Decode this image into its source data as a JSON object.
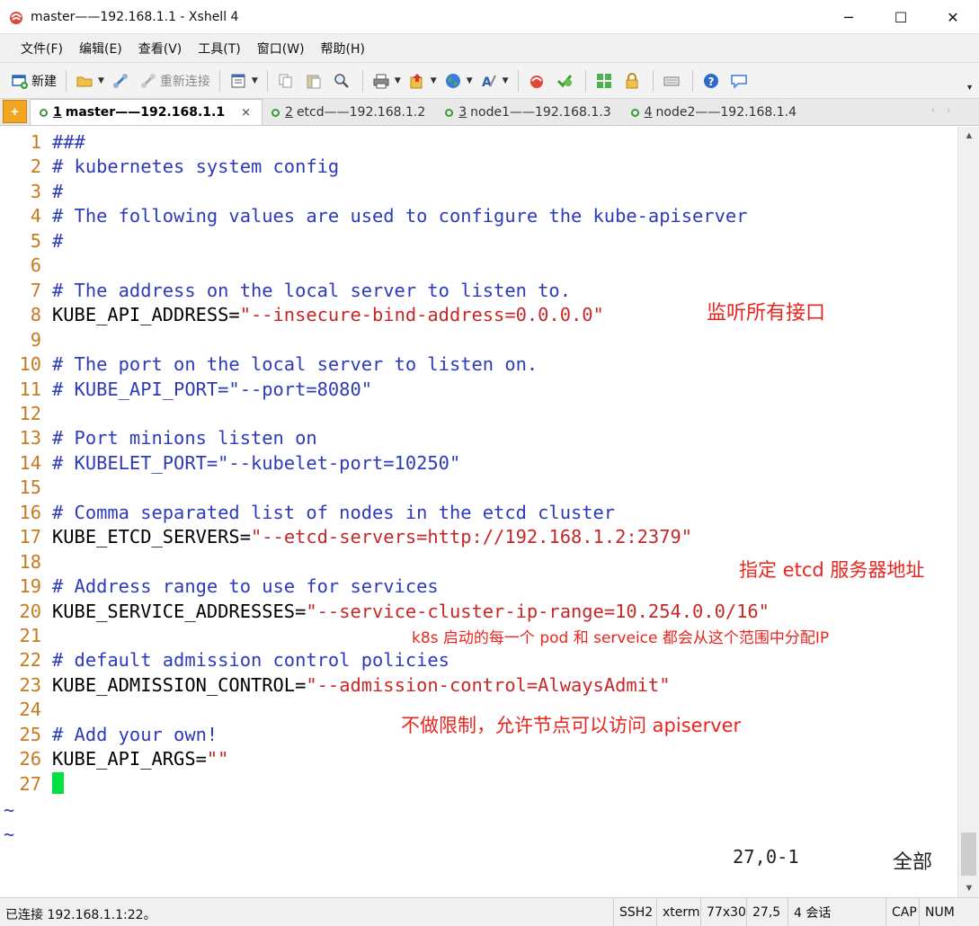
{
  "window": {
    "title": "master——192.168.1.1 - Xshell 4",
    "minimize": "─",
    "maximize": "☐",
    "close": "✕"
  },
  "menu": [
    "文件(F)",
    "编辑(E)",
    "查看(V)",
    "工具(T)",
    "窗口(W)",
    "帮助(H)"
  ],
  "toolbar": {
    "new_label": "新建",
    "reconnect_label": "重新连接"
  },
  "tabs": [
    {
      "num": "1",
      "label": "master——192.168.1.1",
      "active": true
    },
    {
      "num": "2",
      "label": "etcd——192.168.1.2",
      "active": false
    },
    {
      "num": "3",
      "label": "node1——192.168.1.3",
      "active": false
    },
    {
      "num": "4",
      "label": "node2——192.168.1.4",
      "active": false
    }
  ],
  "tab_close": "×",
  "tab_add": "+",
  "file_lines": [
    {
      "n": "1",
      "comment": "###"
    },
    {
      "n": "2",
      "comment": "# kubernetes system config"
    },
    {
      "n": "3",
      "comment": "#"
    },
    {
      "n": "4",
      "comment": "# The following values are used to configure the kube-apiserver"
    },
    {
      "n": "5",
      "comment": "#"
    },
    {
      "n": "6"
    },
    {
      "n": "7",
      "comment": "# The address on the local server to listen to."
    },
    {
      "n": "8",
      "key": "KUBE_API_ADDRESS",
      "value": "\"--insecure-bind-address=0.0.0.0\""
    },
    {
      "n": "9"
    },
    {
      "n": "10",
      "comment": "# The port on the local server to listen on."
    },
    {
      "n": "11",
      "comment": "# KUBE_API_PORT=\"--port=8080\""
    },
    {
      "n": "12"
    },
    {
      "n": "13",
      "comment": "# Port minions listen on"
    },
    {
      "n": "14",
      "comment": "# KUBELET_PORT=\"--kubelet-port=10250\""
    },
    {
      "n": "15"
    },
    {
      "n": "16",
      "comment": "# Comma separated list of nodes in the etcd cluster"
    },
    {
      "n": "17",
      "key": "KUBE_ETCD_SERVERS",
      "value": "\"--etcd-servers=http://192.168.1.2:2379\""
    },
    {
      "n": "18"
    },
    {
      "n": "19",
      "comment": "# Address range to use for services"
    },
    {
      "n": "20",
      "key": "KUBE_SERVICE_ADDRESSES",
      "value": "\"--service-cluster-ip-range=10.254.0.0/16\""
    },
    {
      "n": "21"
    },
    {
      "n": "22",
      "comment": "# default admission control policies"
    },
    {
      "n": "23",
      "key": "KUBE_ADMISSION_CONTROL",
      "value": "\"--admission-control=AlwaysAdmit\""
    },
    {
      "n": "24"
    },
    {
      "n": "25",
      "comment": "# Add your own!"
    },
    {
      "n": "26",
      "key": "KUBE_API_ARGS",
      "value": "\"\""
    },
    {
      "n": "27",
      "cursor": true
    }
  ],
  "tildes": [
    "~",
    "~"
  ],
  "vim_status": {
    "position": "27,0-1",
    "scope": "全部"
  },
  "annotations": {
    "listen_all": "监听所有接口",
    "etcd_addr": "指定 etcd 服务器地址",
    "pod_range": "k8s 启动的每一个 pod 和 serveice 都会从这个范围中分配IP",
    "no_limit": "不做限制，允许节点可以访问 apiserver"
  },
  "statusbar": {
    "connection": "已连接 192.168.1.1:22。",
    "protocol": "SSH2",
    "term": "xterm",
    "size": "77x30",
    "cursor": "27,5",
    "sessions": "4 会话",
    "cap": "CAP",
    "num": "NUM"
  },
  "colors": {
    "comment": "#2d3bb8",
    "string": "#c62828",
    "line_number": "#c87a20",
    "cursor": "#00e040",
    "annotation": "#e8261f"
  }
}
